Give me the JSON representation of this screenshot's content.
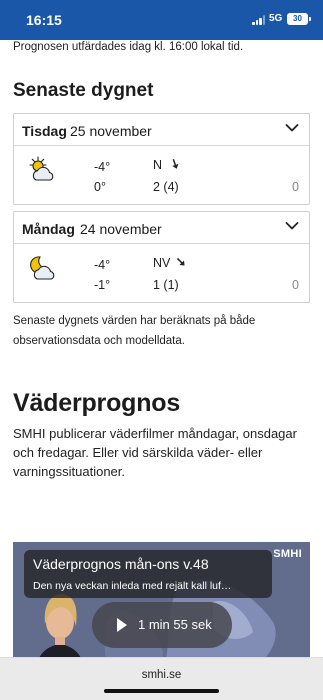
{
  "status_bar": {
    "time": "16:15",
    "network": "5G",
    "battery": "30"
  },
  "intro_text": "Prognosen utfärdades idag kl. 16:00 lokal tid.",
  "recent": {
    "title": "Senaste dygnet",
    "days": [
      {
        "day": "Tisdag",
        "date": "25 november",
        "icon": "sun-behind-cloud-icon",
        "temp_max": "-4°",
        "temp_min": "0°",
        "wind_dir": "N",
        "wind": "2 (4)",
        "precip": "0"
      },
      {
        "day": "Måndag",
        "date": "24 november",
        "icon": "moon-behind-cloud-icon",
        "temp_max": "-4°",
        "temp_min": "-1°",
        "wind_dir": "NV",
        "wind": "1 (1)",
        "precip": "0"
      }
    ],
    "note": "Senaste dygnets värden har beräknats på både observationsdata och modelldata."
  },
  "forecast": {
    "title": "Väderprognos",
    "text": "SMHI publicerar väderfilmer måndagar, onsdagar och fredagar. Eller vid särskilda väder- eller varningssituationer."
  },
  "video": {
    "title": "Väderprognos mån-ons v.48",
    "subtitle": "Den nya veckan inleda med rejält kall luf…",
    "logo": "SMHI",
    "duration": "1 min 55 sek"
  },
  "browser": {
    "url": "smhi.se"
  },
  "colors": {
    "status_bar": "#1a57a8",
    "sun": "#f3c400",
    "cloud": "#e8eef6",
    "moon": "#f3c400"
  }
}
